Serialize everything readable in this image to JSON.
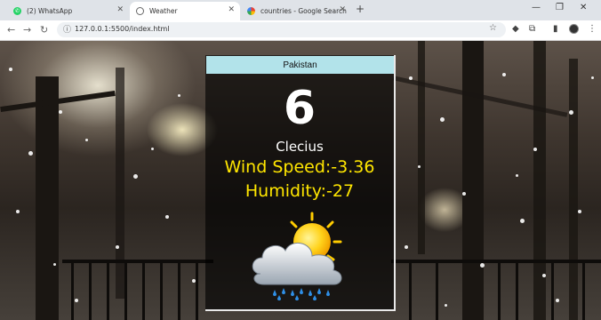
{
  "browser": {
    "tabs": [
      {
        "title": "(2) WhatsApp",
        "icon": "whatsapp-icon",
        "active": false
      },
      {
        "title": "Weather",
        "icon": "globe-icon",
        "active": true
      },
      {
        "title": "countries - Google Search",
        "icon": "google-icon",
        "active": false
      }
    ],
    "new_tab": "+",
    "url": "127.0.0.1:5500/index.html"
  },
  "weather": {
    "city": "Pakistan",
    "temperature": "6",
    "unit": "Clecius",
    "wind": "Wind Speed:-3.36",
    "humidity": "Humidity:-27",
    "icon": "sun-cloud-rain-icon"
  },
  "colors": {
    "card_header": "#b2e3ea",
    "accent_text": "#ffe600"
  }
}
